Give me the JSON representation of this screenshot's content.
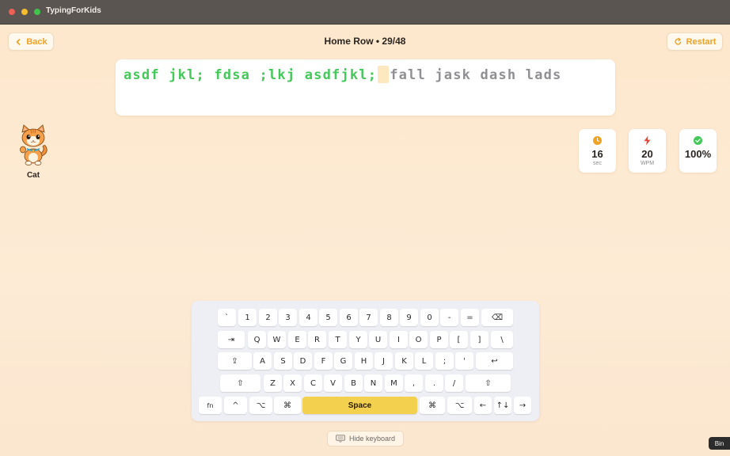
{
  "window": {
    "title": "TypingForKids"
  },
  "header": {
    "back_label": "Back",
    "title": "Home Row • 29/48",
    "restart_label": "Restart"
  },
  "exercise": {
    "typed": "asdf jkl; fdsa ;lkj asdfjkl;",
    "remaining": "fall jask dash lads"
  },
  "mascot": {
    "name": "Cat"
  },
  "stats": {
    "time": {
      "value": "16",
      "unit": "sec",
      "color": "#f0a224"
    },
    "speed": {
      "value": "20",
      "unit": "WPM",
      "color": "#e24536"
    },
    "accuracy": {
      "value": "100%",
      "unit": "",
      "color": "#43c859"
    }
  },
  "keyboard": {
    "row1": [
      "`",
      "1",
      "2",
      "3",
      "4",
      "5",
      "6",
      "7",
      "8",
      "9",
      "0",
      "-",
      "=",
      "⌫"
    ],
    "row2": [
      "⇥",
      "Q",
      "W",
      "E",
      "R",
      "T",
      "Y",
      "U",
      "I",
      "O",
      "P",
      "[",
      "]",
      "\\"
    ],
    "row3": [
      "⇪",
      "A",
      "S",
      "D",
      "F",
      "G",
      "H",
      "J",
      "K",
      "L",
      ";",
      "'",
      "↩"
    ],
    "row4": [
      "⇧",
      "Z",
      "X",
      "C",
      "V",
      "B",
      "N",
      "M",
      ",",
      ".",
      "/",
      "⇧"
    ],
    "row5": [
      "fn",
      "^",
      "⌥",
      "⌘",
      "Space",
      "⌘",
      "⌥",
      "←",
      "↑↓",
      "→"
    ]
  },
  "footer": {
    "hide_keyboard_label": "Hide keyboard"
  },
  "tooltip": {
    "label": "Bin"
  },
  "colors": {
    "accent": "#f0a224",
    "typed": "#43c859",
    "remaining": "#8f8f94",
    "space_key": "#f4d04f",
    "background": "#fde8cd"
  }
}
